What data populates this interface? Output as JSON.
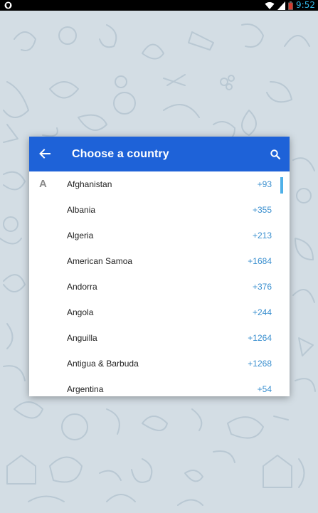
{
  "status_bar": {
    "time": "9:52",
    "colors": {
      "background": "#000000",
      "time": "#33b5e5",
      "battery": "#d63b2f"
    },
    "icons": [
      "shield-icon",
      "wifi-icon",
      "signal-icon",
      "battery-icon"
    ]
  },
  "dialog": {
    "title": "Choose a country",
    "header_color": "#1e62d8",
    "back_icon": "arrow-left-icon",
    "search_icon": "search-icon",
    "section_letter": "A",
    "countries": [
      {
        "name": "Afghanistan",
        "code": "+93"
      },
      {
        "name": "Albania",
        "code": "+355"
      },
      {
        "name": "Algeria",
        "code": "+213"
      },
      {
        "name": "American Samoa",
        "code": "+1684"
      },
      {
        "name": "Andorra",
        "code": "+376"
      },
      {
        "name": "Angola",
        "code": "+244"
      },
      {
        "name": "Anguilla",
        "code": "+1264"
      },
      {
        "name": "Antigua & Barbuda",
        "code": "+1268"
      },
      {
        "name": "Argentina",
        "code": "+54"
      }
    ],
    "code_color": "#3a8fcf",
    "scrollbar_color": "#4fb0e8"
  }
}
